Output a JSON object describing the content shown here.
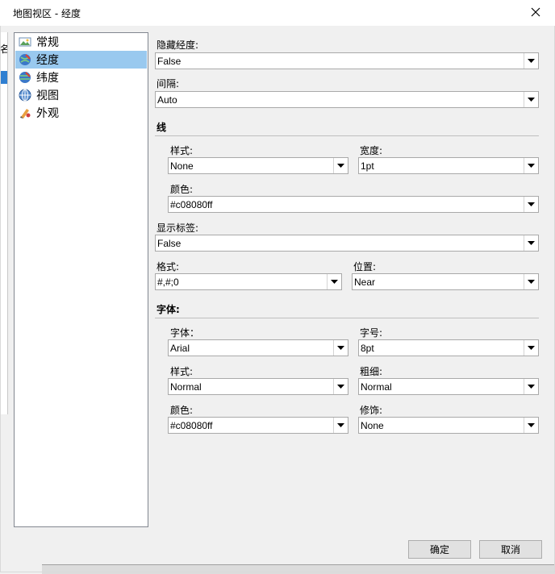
{
  "window": {
    "title": "地图视区 - 经度"
  },
  "background": {
    "left_char": "名"
  },
  "tree": [
    {
      "label": "常规",
      "icon": "general-icon",
      "selected": false
    },
    {
      "label": "经度",
      "icon": "longitude-icon",
      "selected": true
    },
    {
      "label": "纬度",
      "icon": "latitude-icon",
      "selected": false
    },
    {
      "label": "视图",
      "icon": "view-icon",
      "selected": false
    },
    {
      "label": "外观",
      "icon": "appearance-icon",
      "selected": false
    }
  ],
  "props": {
    "hide_label": "隐藏经度:",
    "hide_value": "False",
    "interval_label": "间隔:",
    "interval_value": "Auto",
    "line_section": "线",
    "line_style_label": "样式:",
    "line_style_value": "None",
    "line_width_label": "宽度:",
    "line_width_value": "1pt",
    "line_color_label": "颜色:",
    "line_color_value": "#c08080ff",
    "show_labels_label": "显示标签:",
    "show_labels_value": "False",
    "format_label": "格式:",
    "format_value": "#,#;0",
    "position_label": "位置:",
    "position_value": "Near",
    "font_section": "字体:",
    "font_family_label": "字体：",
    "font_family_value": "Arial",
    "font_size_label": "字号:",
    "font_size_value": "8pt",
    "font_style_label": "样式:",
    "font_style_value": "Normal",
    "font_weight_label": "粗细:",
    "font_weight_value": "Normal",
    "font_color_label": "颜色:",
    "font_color_value": "#c08080ff",
    "decoration_label": "修饰:",
    "decoration_value": "None"
  },
  "buttons": {
    "ok": "确定",
    "cancel": "取消"
  }
}
